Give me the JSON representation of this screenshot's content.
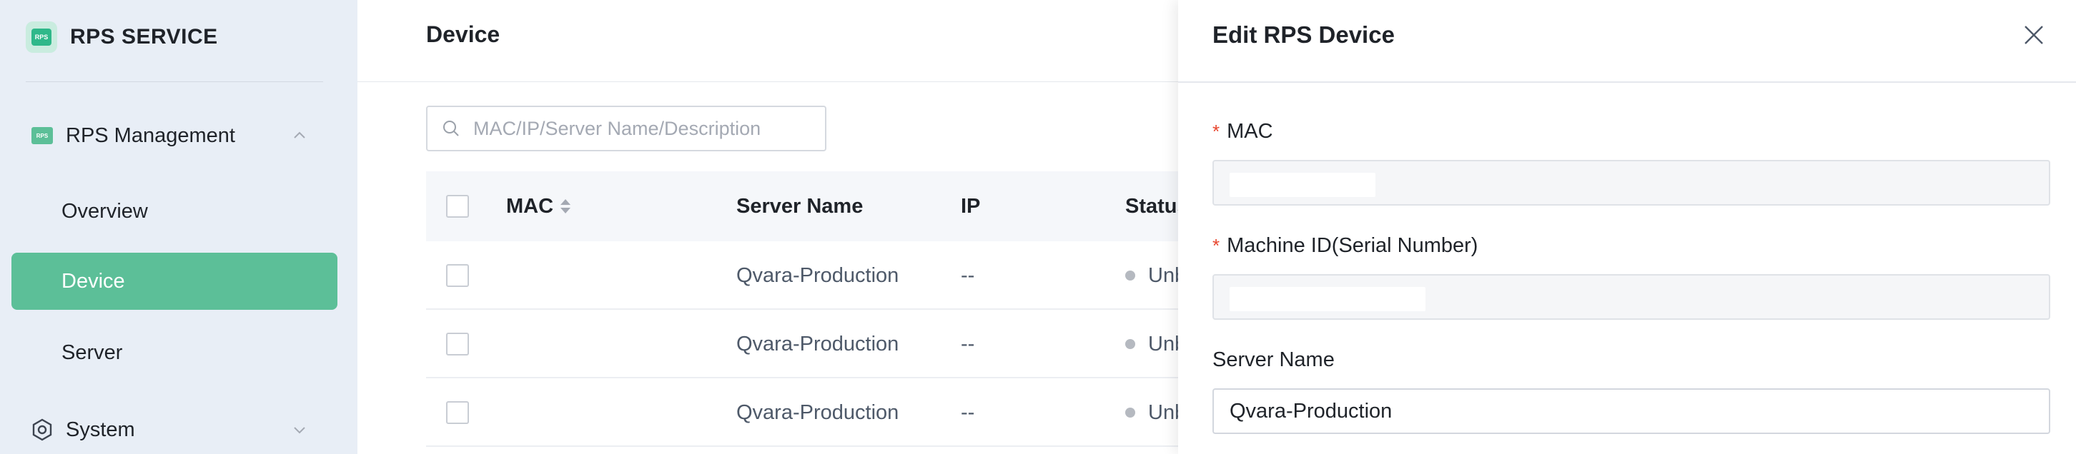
{
  "sidebar": {
    "brand": {
      "logo_text": "RPS",
      "title": "RPS SERVICE"
    },
    "groups": [
      {
        "label": "RPS Management",
        "icon": "rps-icon",
        "icon_text": "RPS",
        "expanded": true
      },
      {
        "label": "System",
        "icon": "gear-icon",
        "expanded": false
      }
    ],
    "items": [
      {
        "label": "Overview",
        "active": false
      },
      {
        "label": "Device",
        "active": true
      },
      {
        "label": "Server",
        "active": false
      }
    ],
    "accent_color": "#5cbf98"
  },
  "main": {
    "page_title": "Device",
    "search": {
      "placeholder": "MAC/IP/Server Name/Description",
      "value": ""
    },
    "table": {
      "columns": [
        "MAC",
        "Server Name",
        "IP",
        "Status"
      ],
      "rows": [
        {
          "mac": "",
          "server_name": "Qvara-Production",
          "ip": "--",
          "status": "Unb"
        },
        {
          "mac": "",
          "server_name": "Qvara-Production",
          "ip": "--",
          "status": "Unb"
        },
        {
          "mac": "",
          "server_name": "Qvara-Production",
          "ip": "--",
          "status": "Unb"
        }
      ]
    }
  },
  "drawer": {
    "title": "Edit RPS Device",
    "fields": [
      {
        "label": "MAC",
        "required": true,
        "value": "",
        "disabled": true
      },
      {
        "label": "Machine ID(Serial Number)",
        "required": true,
        "value": "",
        "disabled": true
      },
      {
        "label": "Server Name",
        "required": false,
        "value": "Qvara-Production",
        "disabled": false
      }
    ],
    "required_mark": "*"
  }
}
